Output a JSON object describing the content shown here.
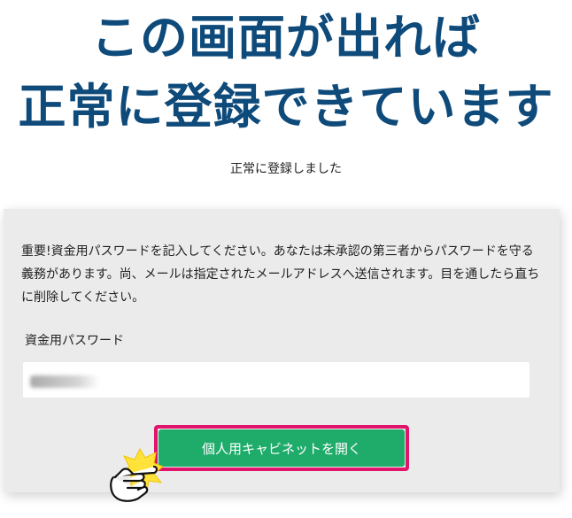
{
  "headline": {
    "line1": "この画面が出れば",
    "line2": "正常に登録できています"
  },
  "success_message": "正常に登録しました",
  "panel": {
    "notice": "重要!資金用パスワードを記入してください。あなたは未承認の第三者からパスワードを守る義務があります。尚、メールは指定されたメールアドレスへ送信されます。目を通したら直ちに削除してください。",
    "field_label": "資金用パスワード",
    "field_value": "",
    "button_label": "個人用キャビネットを開く"
  },
  "colors": {
    "headline": "#0e4a7a",
    "button": "#1fac6a",
    "highlight": "#e0146b",
    "panel": "#ebebeb"
  },
  "icons": {
    "pointer": "pointing-hand-icon"
  }
}
